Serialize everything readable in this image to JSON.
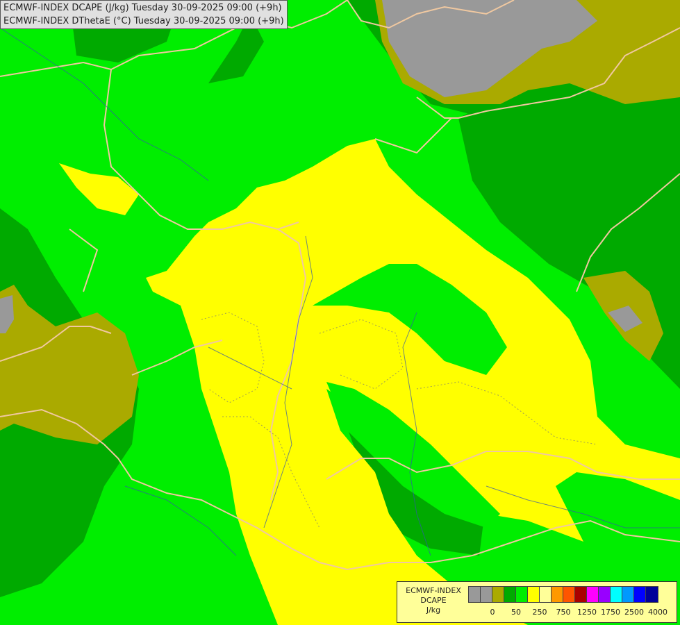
{
  "header": {
    "line1": "ECMWF-INDEX DCAPE (J/kg) Tuesday 30-09-2025 09:00 (+9h)",
    "line2": "ECMWF-INDEX DThetaE (°C) Tuesday 30-09-2025 09:00 (+9h)"
  },
  "legend": {
    "title_line1": "ECMWF-INDEX",
    "title_line2": "DCAPE",
    "unit": "J/kg",
    "colors": [
      "#999999",
      "#999999",
      "#aaaa00",
      "#00aa00",
      "#00ee00",
      "#ffff00",
      "#ffff99",
      "#ff9900",
      "#ff5500",
      "#aa0000",
      "#ff00ff",
      "#9900ff",
      "#00ffff",
      "#0099ff",
      "#0000ff",
      "#000099"
    ],
    "ticks": [
      "0",
      "50",
      "250",
      "750",
      "1250",
      "1750",
      "2500",
      "4000"
    ]
  },
  "map_colors": {
    "gray": "#999999",
    "olive": "#aaaa00",
    "dark_green": "#00aa00",
    "green": "#00ee00",
    "yellow": "#ffff00",
    "border": "#f0c8a0",
    "river": "#3355aa"
  }
}
